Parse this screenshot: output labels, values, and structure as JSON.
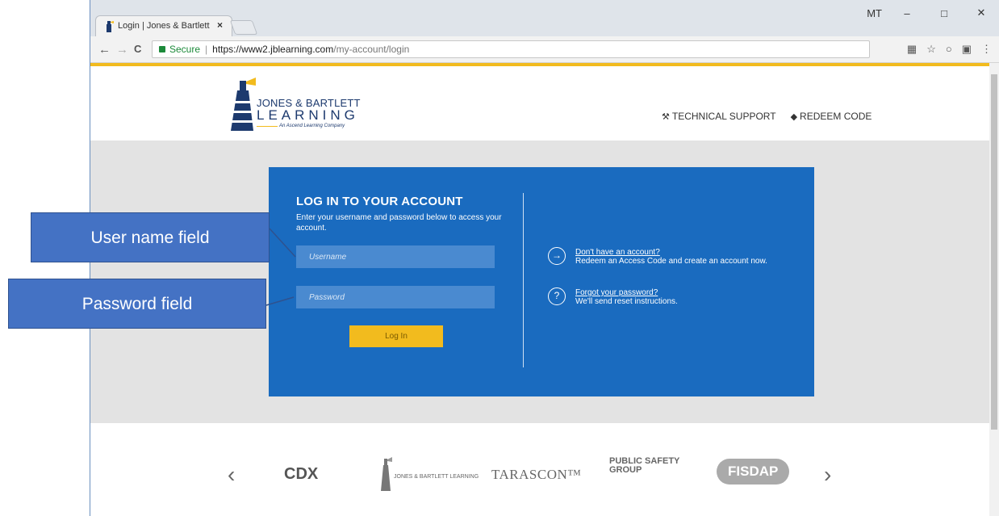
{
  "browser": {
    "tab_title": "Login | Jones & Bartlett L",
    "tab_close": "×",
    "user_label": "MT",
    "window_controls": [
      "–",
      "□",
      "✕"
    ],
    "nav": {
      "back": "←",
      "forward": "→",
      "reload": "C"
    },
    "secure_label": "Secure",
    "url_host": "https://www2.jblearning.com",
    "url_path": "/my-account/login",
    "right_icons": [
      "▦",
      "☆",
      "○",
      "▣",
      "⋮"
    ]
  },
  "header": {
    "logo_line1": "JONES & BARTLETT",
    "logo_line2": "LEARNING",
    "logo_line3": "An Ascend Learning Company",
    "links": [
      {
        "icon": "wrench-icon",
        "glyph": "🔧",
        "label": "TECHNICAL SUPPORT"
      },
      {
        "icon": "tag-icon",
        "glyph": "◆",
        "label": "REDEEM CODE"
      }
    ]
  },
  "login": {
    "title": "LOG IN TO YOUR ACCOUNT",
    "subtitle": "Enter your username and password below to access your account.",
    "username_placeholder": "Username",
    "password_placeholder": "Password",
    "login_button": "Log In",
    "help": [
      {
        "icon": "→",
        "link": "Don't have an account?",
        "text": "Redeem an Access Code and create an account now."
      },
      {
        "icon": "?",
        "link": "Forgot your password?",
        "text": "We'll send reset instructions."
      }
    ]
  },
  "carousel": {
    "prev": "‹",
    "next": "›",
    "brands": [
      "CDX",
      "JONES & BARTLETT LEARNING",
      "TARASCON™",
      "PUBLIC SAFETY GROUP",
      "FISDAP"
    ]
  },
  "annotations": {
    "username_callout": "User name field",
    "password_callout": "Password field"
  },
  "colors": {
    "panel_blue": "#1a6bbf",
    "accent_yellow": "#f2bb1e",
    "callout_blue": "#4472c4"
  }
}
